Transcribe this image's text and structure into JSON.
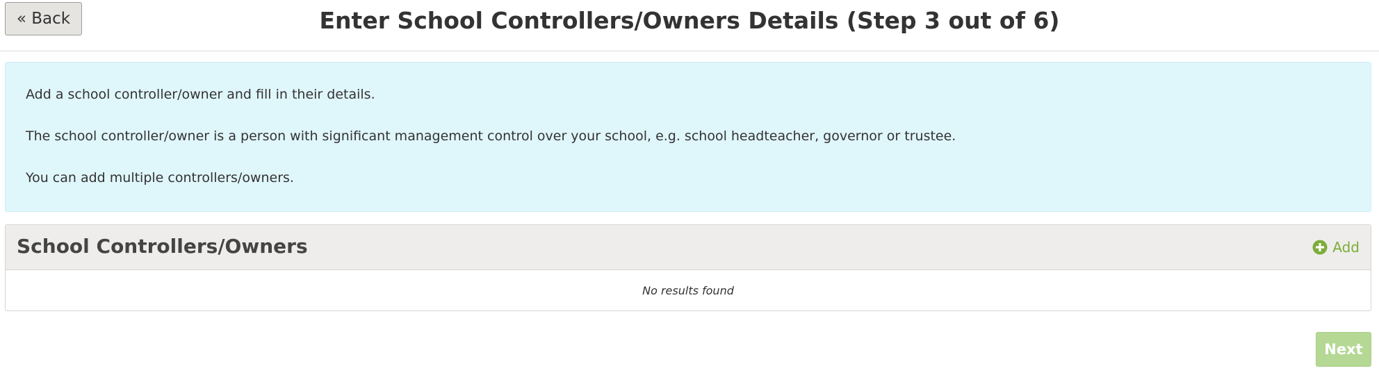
{
  "header": {
    "back_label": "« Back",
    "title": "Enter School Controllers/Owners Details (Step 3 out of 6)"
  },
  "info": {
    "line1": "Add a school controller/owner and fill in their details.",
    "line2": "The school controller/owner is a person with significant management control over your school, e.g. school headteacher, governor or trustee.",
    "line3": "You can add multiple controllers/owners."
  },
  "panel": {
    "title": "School Controllers/Owners",
    "add_label": "Add",
    "add_icon": "plus-circle-icon",
    "empty_text": "No results found"
  },
  "footer": {
    "next_label": "Next",
    "next_enabled": false
  },
  "colors": {
    "info_background": "#dff6fb",
    "panel_header_background": "#eeedeb",
    "add_link": "#7cad3a",
    "next_button_disabled": "#b5d895"
  }
}
